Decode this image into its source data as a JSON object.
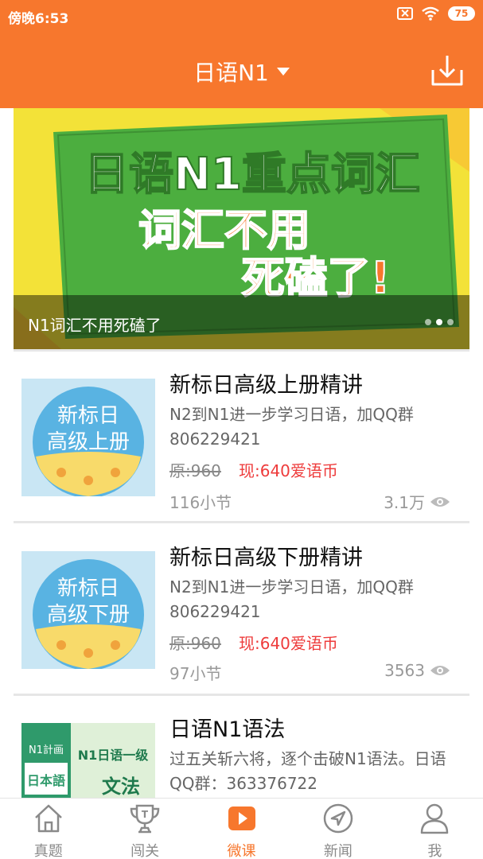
{
  "status_bar": {
    "time": "傍晚6:53",
    "battery": "75"
  },
  "header": {
    "title": "日语N1"
  },
  "banner": {
    "headline": "日语N1重点词汇",
    "line2": "词汇不用",
    "line3": "死磕了!",
    "caption": "N1词汇不用死磕了"
  },
  "courses": [
    {
      "title": "新标日高级上册精讲",
      "desc": "N2到N1进一步学习日语，加QQ群806229421",
      "price_old": "原:960",
      "price_new": "现:640爱语币",
      "lessons": "116小节",
      "views": "3.1万",
      "thumb_text": [
        "新标日",
        "高级上册"
      ]
    },
    {
      "title": "新标日高级下册精讲",
      "desc": "N2到N1进一步学习日语，加QQ群806229421",
      "price_old": "原:960",
      "price_new": "现:640爱语币",
      "lessons": "97小节",
      "views": "3563",
      "thumb_text": [
        "新标日",
        "高级下册"
      ]
    },
    {
      "title": "日语N1语法",
      "desc": "过五关斩六将，逐个击破N1语法。日语QQ群：363376722",
      "thumb_text": [
        "N1計画",
        "N1日语一级",
        "日本語",
        "文法"
      ]
    }
  ],
  "tabs": [
    {
      "label": "真题",
      "icon": "home-icon"
    },
    {
      "label": "闯关",
      "icon": "trophy-icon"
    },
    {
      "label": "微课",
      "icon": "play-icon"
    },
    {
      "label": "新闻",
      "icon": "compass-icon"
    },
    {
      "label": "我",
      "icon": "person-icon"
    }
  ],
  "colors": {
    "accent": "#f7772d",
    "price_red": "#ee3b3b",
    "banner_green": "#4cae3f",
    "banner_yellow": "#f3e238"
  }
}
